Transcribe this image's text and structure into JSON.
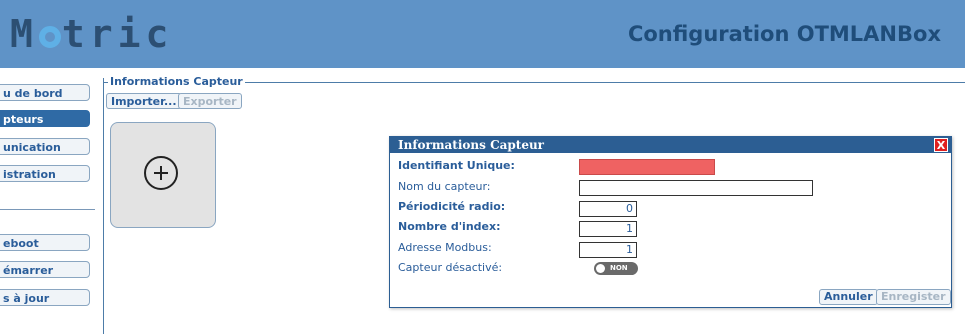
{
  "header": {
    "logo_text": "Metric",
    "title": "Configuration OTMLANBox",
    "bar_color": "#5f93c7"
  },
  "sidebar": {
    "items": [
      {
        "label": "u de bord",
        "active": false
      },
      {
        "label": "pteurs",
        "active": true
      },
      {
        "label": "unication",
        "active": false
      },
      {
        "label": "istration",
        "active": false
      },
      {
        "label": "eboot",
        "active": false
      },
      {
        "label": "émarrer",
        "active": false
      },
      {
        "label": "s à jour",
        "active": false
      }
    ]
  },
  "section": {
    "legend": "Informations Capteur",
    "import_label": "Importer...",
    "export_label": "Exporter",
    "add_icon": "plus-circle-icon"
  },
  "dialog": {
    "title": "Informations Capteur",
    "close_label": "X",
    "fields": {
      "unique_id": {
        "label": "Identifiant Unique:",
        "value": ""
      },
      "sensor_name": {
        "label": "Nom du capteur:",
        "value": ""
      },
      "radio_period": {
        "label": "Périodicité radio:",
        "value": "0"
      },
      "index_count": {
        "label": "Nombre d'index:",
        "value": "1"
      },
      "modbus_address": {
        "label": "Adresse Modbus:",
        "value": "1"
      },
      "sensor_disabled": {
        "label": "Capteur désactivé:",
        "value": "NON"
      }
    },
    "cancel_label": "Annuler",
    "save_label": "Enregister"
  },
  "colors": {
    "accent": "#2c5e93",
    "error_field": "#ef6262",
    "link_text": "#2a5d9a"
  }
}
